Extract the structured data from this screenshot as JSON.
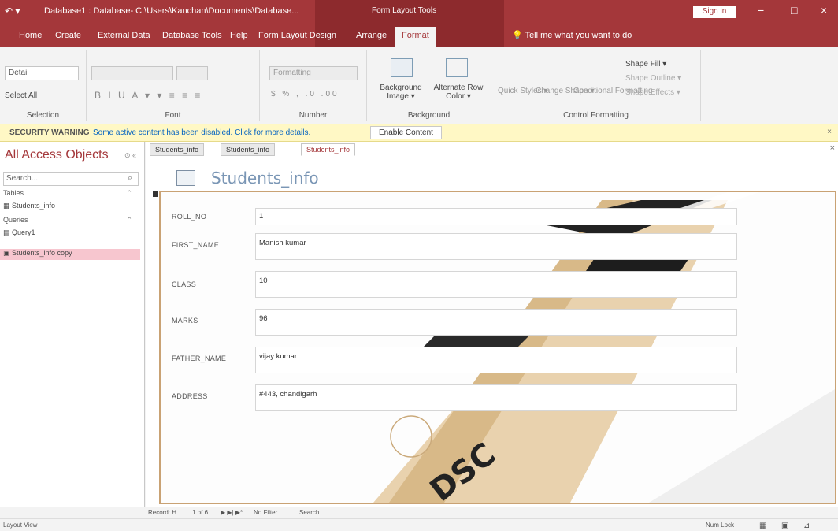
{
  "titlebar": {
    "quick_access": "↶ ▾",
    "document_path": "Database1 : Database- C:\\Users\\Kanchan\\Documents\\Database...",
    "context_tools": "Form Layout Tools",
    "signin": "Sign in",
    "minimize": "−",
    "restore": "□",
    "close": "×"
  },
  "tabs": {
    "items": [
      "Home",
      "Create",
      "External Data",
      "Database Tools",
      "Help",
      "Form Layout Design",
      "Arrange",
      "Format"
    ],
    "active": "Format",
    "tell_me": "Tell me what you want to do"
  },
  "ribbon": {
    "selection": {
      "dropdown": "Detail",
      "select_all": "Select All",
      "label": "Selection"
    },
    "font": {
      "label": "Font",
      "glyphs": "B I U A ▾ ▾ ≡ ≡ ≡"
    },
    "number": {
      "dropdown": "Formatting",
      "glyphs": "$ % , .0 .00",
      "label": "Number"
    },
    "background": {
      "background_image": "Background Image ▾",
      "alternate_row_color": "Alternate Row Color ▾",
      "label": "Background"
    },
    "control_formatting": {
      "quick_styles": "Quick Styles ▾",
      "change_shape": "Change Shape ▾",
      "conditional_formatting": "Conditional Formatting",
      "shape_fill": "Shape Fill ▾",
      "shape_outline": "Shape Outline ▾",
      "shape_effects": "Shape Effects ▾",
      "label": "Control Formatting"
    }
  },
  "security": {
    "label": "SECURITY WARNING",
    "message": "Some active content has been disabled. Click for more details.",
    "button": "Enable Content",
    "close": "×"
  },
  "nav_pane": {
    "title": "All Access Objects",
    "search_placeholder": "Search...",
    "sections": [
      {
        "name": "Tables",
        "items": [
          "Students_info"
        ]
      },
      {
        "name": "Queries",
        "items": [
          "Query1"
        ]
      }
    ],
    "selected_item": "Students_info copy"
  },
  "doc_tabs": [
    "Students_info",
    "Students_info",
    "Students_info"
  ],
  "form": {
    "title": "Students_info",
    "fields": [
      {
        "label": "ROLL_NO",
        "value": "1"
      },
      {
        "label": "FIRST_NAME",
        "value": "Manish kumar"
      },
      {
        "label": "CLASS",
        "value": "10"
      },
      {
        "label": "MARKS",
        "value": "96"
      },
      {
        "label": "FATHER_NAME",
        "value": "vijay kumar"
      },
      {
        "label": "ADDRESS",
        "value": "#443, chandigarh"
      }
    ]
  },
  "background_art": {
    "brand_text": "DSC"
  },
  "record_nav": {
    "label": "Record: H",
    "position": "1 of 6",
    "buttons": "▶ ▶| ▶*",
    "filter": "No Filter",
    "search": "Search"
  },
  "status": {
    "view": "Layout View",
    "numlock": "Num Lock"
  },
  "colors": {
    "accent": "#a4373a",
    "accent_dark": "#8d2a2d",
    "selection_pink": "#f7c6cf",
    "form_border": "#c9a274",
    "form_title": "#7a96b5"
  }
}
